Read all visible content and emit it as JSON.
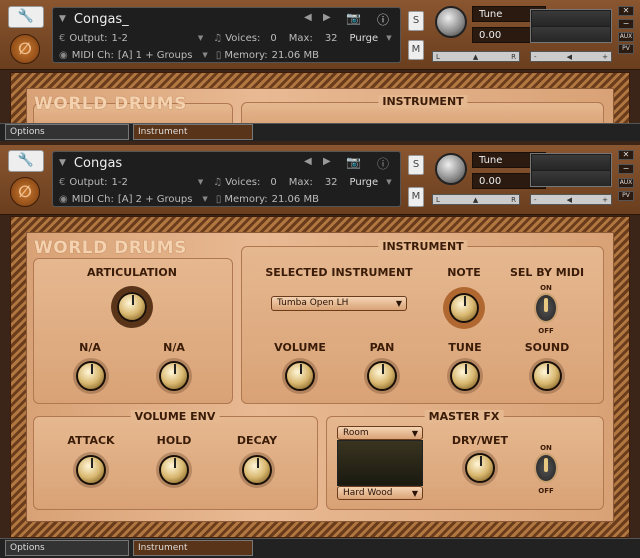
{
  "top_instance": {
    "name": "Congas_",
    "output_label": "Output:",
    "output_value": "1-2",
    "voices_label": "Voices:",
    "voices_value": "0",
    "max_label": "Max:",
    "max_value": "32",
    "purge_label": "Purge",
    "midi_label": "MIDI Ch:",
    "midi_value": "[A]  1 + Groups",
    "memory_label": "Memory:",
    "memory_value": "21.06 MB",
    "s_label": "S",
    "m_label": "M",
    "tune_label": "Tune",
    "tune_value": "0.00",
    "aux_label": "AUX",
    "pv_label": "PV",
    "pan_l": "L",
    "pan_r": "R",
    "panel_title": "WORLD DRUMS",
    "instrument_title": "INSTRUMENT",
    "tab_options": "Options",
    "tab_instrument": "Instrument"
  },
  "main_instance": {
    "name": "Congas",
    "output_label": "Output:",
    "output_value": "1-2",
    "voices_label": "Voices:",
    "voices_value": "0",
    "max_label": "Max:",
    "max_value": "32",
    "purge_label": "Purge",
    "midi_label": "MIDI Ch:",
    "midi_value": "[A]  2 + Groups",
    "memory_label": "Memory:",
    "memory_value": "21.06 MB",
    "s_label": "S",
    "m_label": "M",
    "tune_label": "Tune",
    "tune_value": "0.00",
    "aux_label": "AUX",
    "pv_label": "PV",
    "pan_minus": "-",
    "pan_plus": "+"
  },
  "panel": {
    "title": "WORLD DRUMS",
    "articulation": "ARTICULATION",
    "na1": "N/A",
    "na2": "N/A",
    "instrument_title": "INSTRUMENT",
    "selected_instrument": "SELECTED INSTRUMENT",
    "selected_value": "Tumba Open LH",
    "note": "NOTE",
    "sel_by_midi": "SEL BY MIDI",
    "on": "ON",
    "off": "OFF",
    "volume": "VOLUME",
    "pan": "PAN",
    "tune": "TUNE",
    "sound": "SOUND",
    "volume_env": "VOLUME ENV",
    "attack": "ATTACK",
    "hold": "HOLD",
    "decay": "DECAY",
    "master_fx": "MASTER FX",
    "room": "Room",
    "hard_wood": "Hard Wood",
    "dry_wet": "DRY/WET",
    "on2": "ON",
    "off2": "OFF"
  },
  "bottom_tabs": {
    "options": "Options",
    "instrument": "Instrument"
  }
}
